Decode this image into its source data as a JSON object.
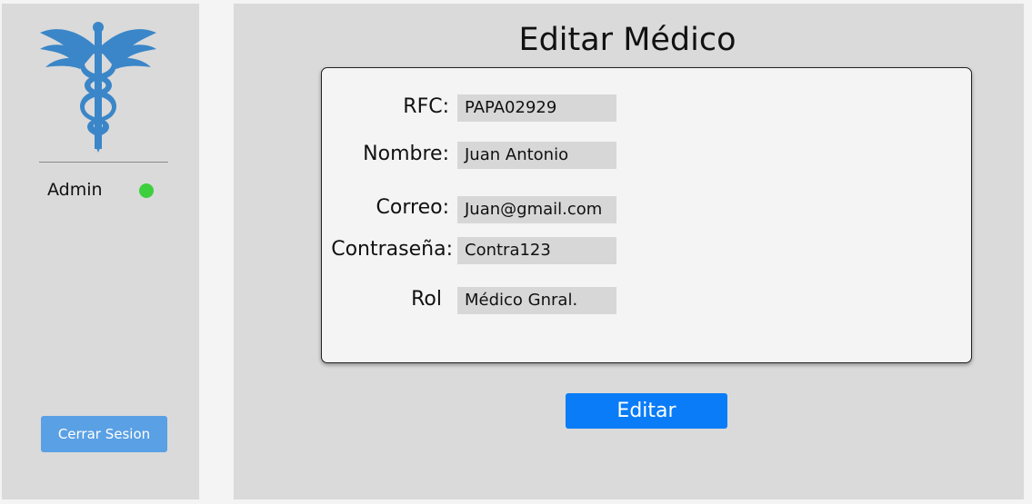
{
  "sidebar": {
    "logo_icon": "caduceus-icon",
    "user_name": "Admin",
    "status_color": "#3ecf3e",
    "logout_label": "Cerrar Sesion"
  },
  "main": {
    "title": "Editar Médico",
    "fields": [
      {
        "label": "RFC:",
        "value": "PAPA02929"
      },
      {
        "label": "Nombre:",
        "value": "Juan Antonio"
      },
      {
        "label": "Correo:",
        "value": "Juan@gmail.com"
      },
      {
        "label": "Contraseña:",
        "value": "Contra123"
      },
      {
        "label": "Rol",
        "value": "Médico Gnral."
      }
    ],
    "submit_label": "Editar"
  },
  "colors": {
    "accent": "#0a7cf7",
    "logo": "#3a86c8",
    "panel": "#dadada"
  }
}
